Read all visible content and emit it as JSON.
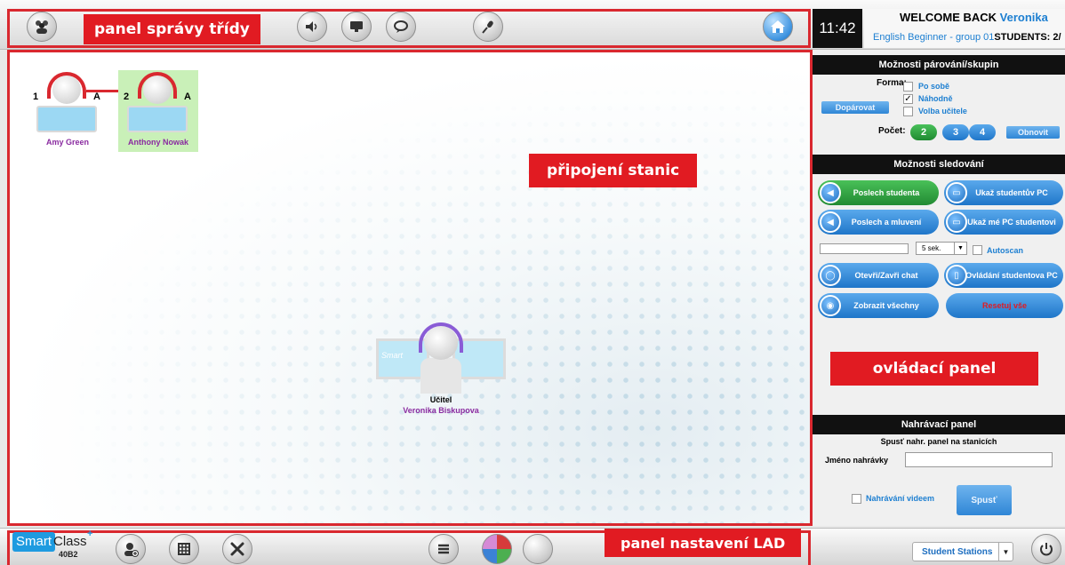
{
  "colors": {
    "annotation_red": "#e11b22",
    "accent_blue": "#1d7fd1",
    "student_purple": "#8a2ba0",
    "listen_green": "#2eaa3e"
  },
  "annotations": {
    "class_panel": "panel správy třídy",
    "stations": "připojení stanic",
    "control_panel": "ovládací panel",
    "lad_panel": "panel nastavení LAD"
  },
  "topbar": {
    "icons": [
      "group-icon",
      "speaker-icon",
      "monitor-icon",
      "chat-icon",
      "microphone-icon",
      "home-icon"
    ],
    "clock": "11:42",
    "welcome_prefix": "WELCOME BACK",
    "welcome_name": "Veronika",
    "class_name": "English Beginner - group 01",
    "students_label": "STUDENTS: 2/"
  },
  "stations": [
    {
      "number": "1",
      "group": "A",
      "name": "Amy Green",
      "selected": false
    },
    {
      "number": "2",
      "group": "A",
      "name": "Anthony Nowak",
      "selected": true
    }
  ],
  "teacher": {
    "role": "Učitel",
    "name": "Veronika Biskupova",
    "brand": "Smart"
  },
  "pairing": {
    "title": "Možnosti párování/skupin",
    "form_label": "Forma:",
    "options": [
      {
        "label": "Po sobě",
        "checked": false
      },
      {
        "label": "Náhodně",
        "checked": true
      },
      {
        "label": "Volba učitele",
        "checked": false
      }
    ],
    "pair_button": "Dopárovat",
    "count_label": "Počet:",
    "counts": [
      "2",
      "3",
      "4"
    ],
    "refresh_button": "Obnovit"
  },
  "monitoring": {
    "title": "Možnosti sledování",
    "buttons": [
      {
        "label": "Poslech studenta",
        "icon": "speaker-icon"
      },
      {
        "label": "Ukaž studentův PC",
        "icon": "monitor-icon"
      },
      {
        "label": "Poslech a mluvení",
        "icon": "speaker-icon"
      },
      {
        "label": "Ukaž mé PC studentovi",
        "icon": "monitor-icon"
      },
      {
        "label": "Otevři/Zavři chat",
        "icon": "chat-icon"
      },
      {
        "label": "Ovládání studentova PC",
        "icon": "mouse-icon"
      },
      {
        "label": "Zobrazit všechny",
        "icon": "eye-icon"
      },
      {
        "label": "Resetuj vše"
      }
    ],
    "interval_value": "5 sek.",
    "autoscan_label": "Autoscan"
  },
  "recording": {
    "title": "Nahrávací panel",
    "subtitle": "Spusť nahr. panel na stanicích",
    "name_label": "Jméno nahrávky",
    "name_value": "",
    "video_label": "Nahrávání videem",
    "start_button": "Spusť"
  },
  "bottombar": {
    "logo_smart": "Smart",
    "logo_class": "Class",
    "logo_plus": "+",
    "logo_code": "40B2",
    "icons": [
      "add-user-icon",
      "grid-icon",
      "tools-icon",
      "list-icon",
      "pie-chart-icon",
      "circle-icon",
      "power-icon"
    ],
    "view_select": "Student Stations"
  }
}
